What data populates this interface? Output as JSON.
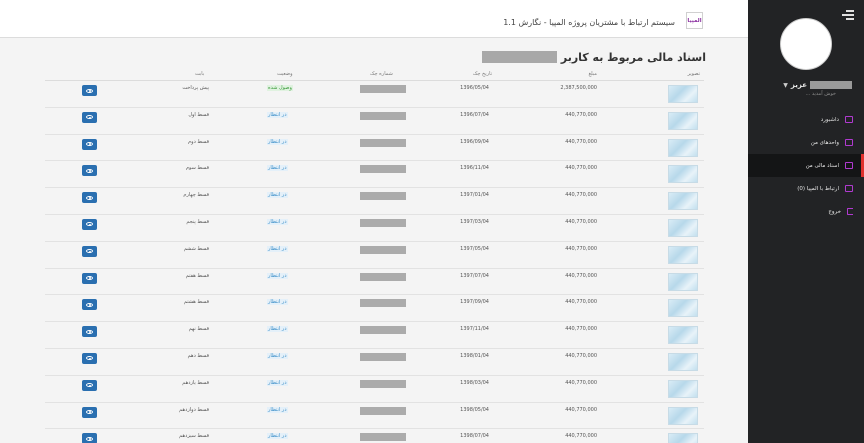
{
  "header": {
    "title": "سیستم ارتباط با مشتریان پروژه المپیا - نگارش 1.1",
    "logo_text": "المپیا"
  },
  "sidebar": {
    "user_name": "عزیز",
    "welcome": "خوش آمدید ...",
    "items": [
      {
        "label": "داشبورد",
        "icon": "dashboard-icon",
        "active": false
      },
      {
        "label": "واحدهای من",
        "icon": "units-icon",
        "active": false
      },
      {
        "label": "اسناد مالی من",
        "icon": "documents-icon",
        "active": true
      },
      {
        "label": "ارتباط با المپیا (0)",
        "icon": "message-icon",
        "active": false
      },
      {
        "label": "خروج",
        "icon": "logout-icon",
        "active": false
      }
    ]
  },
  "page": {
    "title": "اسناد مالی مربوط به کاربر"
  },
  "table": {
    "headers": {
      "image": "تصویر",
      "amount": "مبلغ",
      "date": "تاریخ چک",
      "cheque": "شماره چک",
      "status": "وضعیت",
      "reason": "بابت"
    },
    "rows": [
      {
        "amount": "2,387,500,000",
        "date": "1396/05/04",
        "status": "وصول شده",
        "status_type": "ok",
        "reason": "پیش پرداخت"
      },
      {
        "amount": "440,770,000",
        "date": "1396/07/04",
        "status": "در انتظار",
        "status_type": "wait",
        "reason": "قسط اول"
      },
      {
        "amount": "440,770,000",
        "date": "1396/09/04",
        "status": "در انتظار",
        "status_type": "wait",
        "reason": "قسط دوم"
      },
      {
        "amount": "440,770,000",
        "date": "1396/11/04",
        "status": "در انتظار",
        "status_type": "wait",
        "reason": "قسط سوم"
      },
      {
        "amount": "440,770,000",
        "date": "1397/01/04",
        "status": "در انتظار",
        "status_type": "wait",
        "reason": "قسط چهارم"
      },
      {
        "amount": "440,770,000",
        "date": "1397/03/04",
        "status": "در انتظار",
        "status_type": "wait",
        "reason": "قسط پنجم"
      },
      {
        "amount": "440,770,000",
        "date": "1397/05/04",
        "status": "در انتظار",
        "status_type": "wait",
        "reason": "قسط ششم"
      },
      {
        "amount": "440,770,000",
        "date": "1397/07/04",
        "status": "در انتظار",
        "status_type": "wait",
        "reason": "قسط هفتم"
      },
      {
        "amount": "440,770,000",
        "date": "1397/09/04",
        "status": "در انتظار",
        "status_type": "wait",
        "reason": "قسط هشتم"
      },
      {
        "amount": "440,770,000",
        "date": "1397/11/04",
        "status": "در انتظار",
        "status_type": "wait",
        "reason": "قسط نهم"
      },
      {
        "amount": "440,770,000",
        "date": "1398/01/04",
        "status": "در انتظار",
        "status_type": "wait",
        "reason": "قسط دهم"
      },
      {
        "amount": "440,770,000",
        "date": "1398/03/04",
        "status": "در انتظار",
        "status_type": "wait",
        "reason": "قسط یازدهم"
      },
      {
        "amount": "440,770,000",
        "date": "1398/05/04",
        "status": "در انتظار",
        "status_type": "wait",
        "reason": "قسط دوازدهم"
      },
      {
        "amount": "440,770,000",
        "date": "1398/07/04",
        "status": "در انتظار",
        "status_type": "wait",
        "reason": "قسط سیزدهم"
      }
    ]
  },
  "colors": {
    "sidebar_bg": "#222325",
    "active_accent": "#e0312e",
    "icon_purple": "#b03ad0",
    "view_button": "#2a6fb0",
    "status_ok": "#3a9a3a",
    "status_wait": "#3b8ec8"
  }
}
